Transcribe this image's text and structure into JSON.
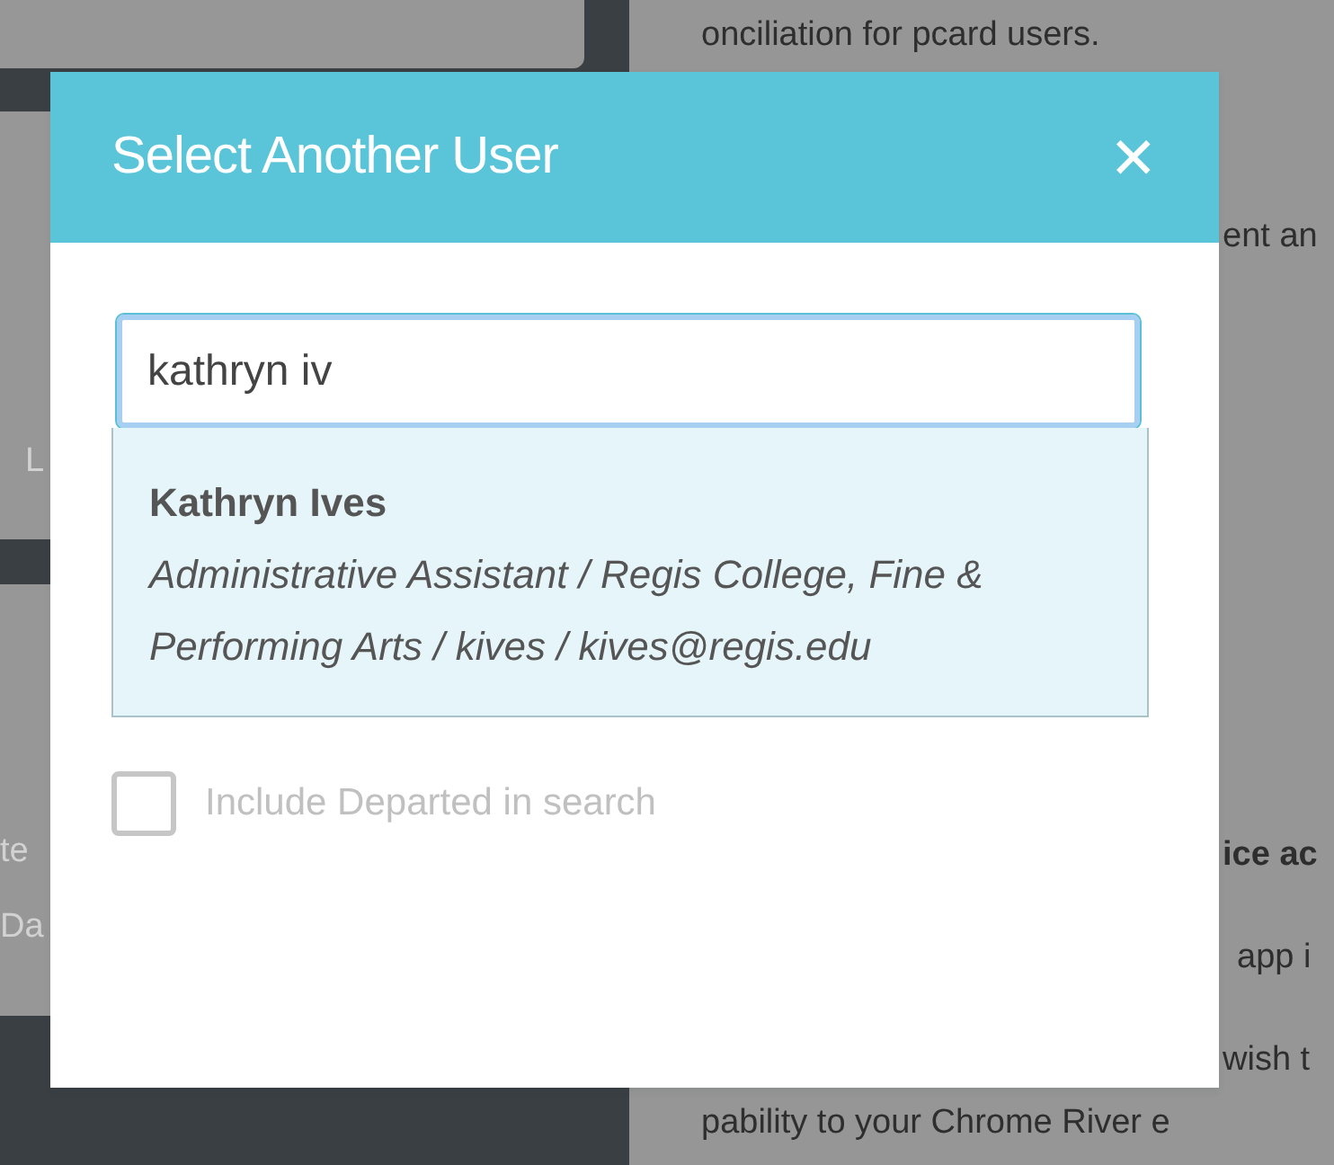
{
  "background": {
    "left_fragments": [
      "L",
      "te",
      "Da"
    ],
    "right_fragments": [
      {
        "text": "onciliation for pcard users.",
        "kind": "full",
        "bold": false
      },
      {
        "text": "ent an",
        "kind": "edge",
        "bold": false
      },
      {
        "text": "ice ac",
        "kind": "edge",
        "bold": true
      },
      {
        "text": "app i",
        "kind": "edge",
        "bold": false
      },
      {
        "text": "wish t",
        "kind": "edge",
        "bold": false
      },
      {
        "text": "pability to your Chrome River e",
        "kind": "full",
        "bold": false
      }
    ]
  },
  "dialog": {
    "title": "Select Another User",
    "close": "✕",
    "search": {
      "value": "kathryn iv"
    },
    "results": [
      {
        "name": "Kathryn Ives",
        "details": "Administrative Assistant / Regis College, Fine & Performing Arts / kives / kives@regis.edu",
        "selected": true
      }
    ],
    "include_departed": {
      "label": "Include Departed in search",
      "checked": false,
      "disabled": true
    }
  }
}
